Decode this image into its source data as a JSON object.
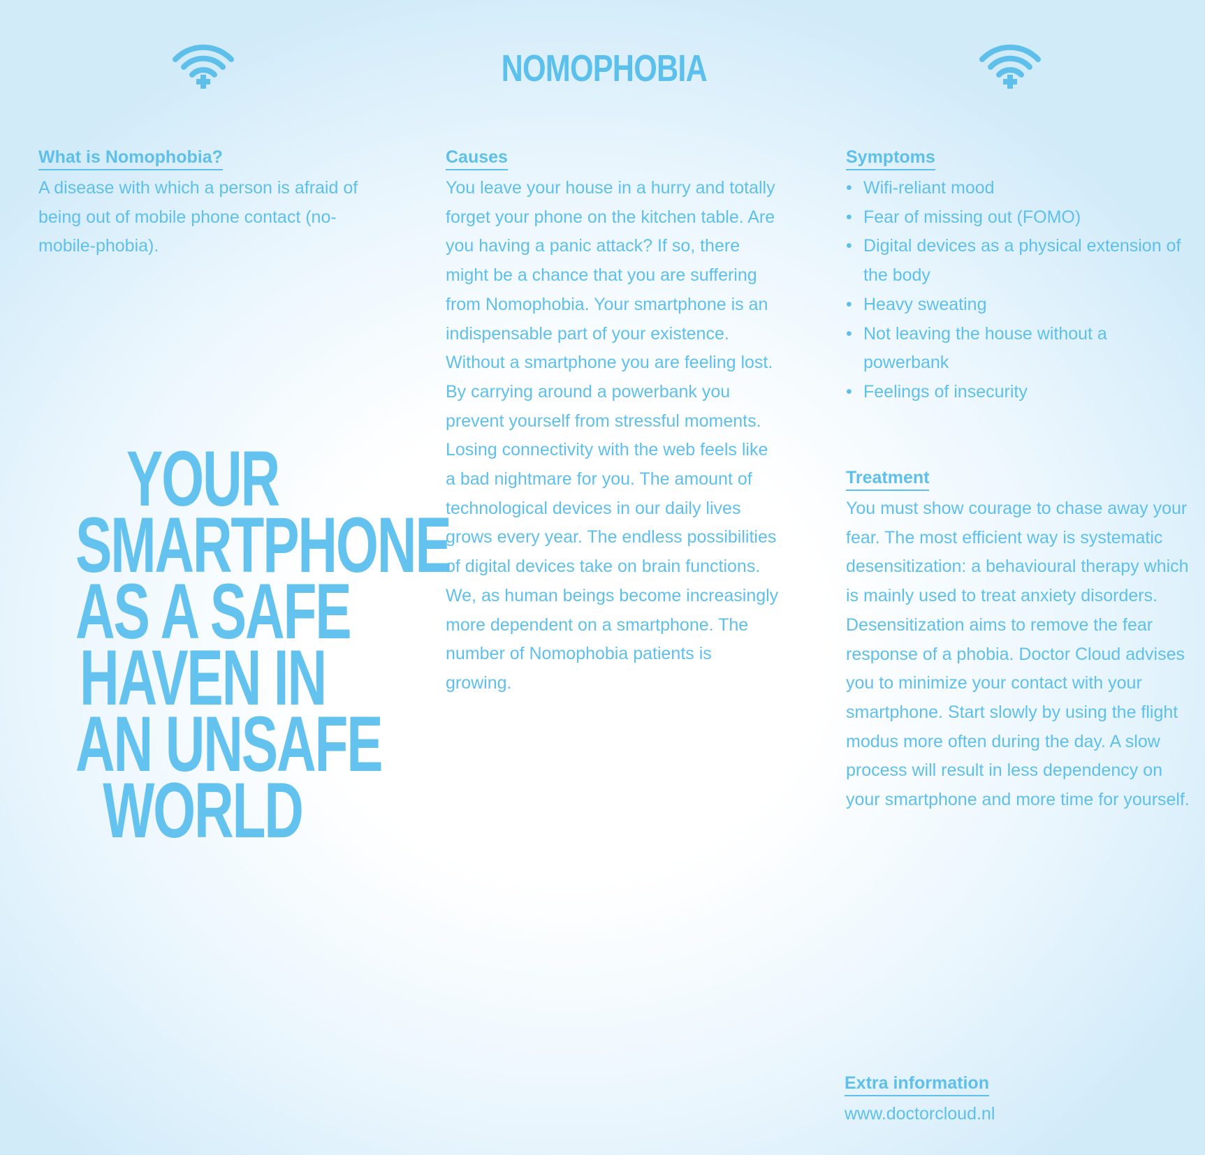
{
  "header": {
    "title": "NOMOPHOBIA",
    "icons": [
      "wifi-plus-icon",
      "wifi-plus-icon"
    ]
  },
  "what": {
    "heading": "What is Nomophobia?",
    "body": "A disease with which a person is afraid of being out of mobile phone contact (no-mobile-phobia)."
  },
  "slogan": {
    "lines": [
      "YOUR",
      "SMARTPHONE",
      "AS A SAFE",
      "HAVEN IN",
      "AN UNSAFE",
      "WORLD"
    ]
  },
  "causes": {
    "heading": "Causes",
    "body": "You leave your house in a hurry and totally forget your phone on the kitchen table. Are you having a panic attack? If so, there might be a chance that you are suffering from Nomophobia. Your smartphone is an indispensable part of your existence. Without a smartphone you are feeling lost. By carrying around a powerbank you prevent yourself from stressful moments. Losing connectivity with the web feels like a bad nightmare for you. The amount of technological devices in our daily lives grows every year. The endless possibilities of digital devices take on brain functions.",
    "body2": "We, as human beings become increasingly more dependent on a smartphone. The number of Nomophobia patients is growing."
  },
  "symptoms": {
    "heading": "Symptoms",
    "items": [
      "Wifi-reliant mood",
      "Fear of missing out (FOMO)",
      "Digital devices as a physical extension of the body",
      "Heavy sweating",
      "Not leaving the house without a powerbank",
      "Feelings of insecurity"
    ]
  },
  "treatment": {
    "heading": "Treatment",
    "body": "You must show courage to chase away your fear. The most efficient way is systematic desensitization: a behavioural therapy which is mainly used to treat anxiety disorders. Desensitization aims to remove the fear response of a phobia. Doctor Cloud advises you to minimize your contact with your smartphone. Start slowly by using the flight modus more often during the day. A slow process will result in less dependency on your smartphone and more time for yourself."
  },
  "extra": {
    "heading": "Extra information",
    "link": "www.doctorcloud.nl"
  },
  "colors": {
    "text": "#5ec0ea",
    "background_center": "#ffffff",
    "background_edge": "#d2ebf9"
  }
}
